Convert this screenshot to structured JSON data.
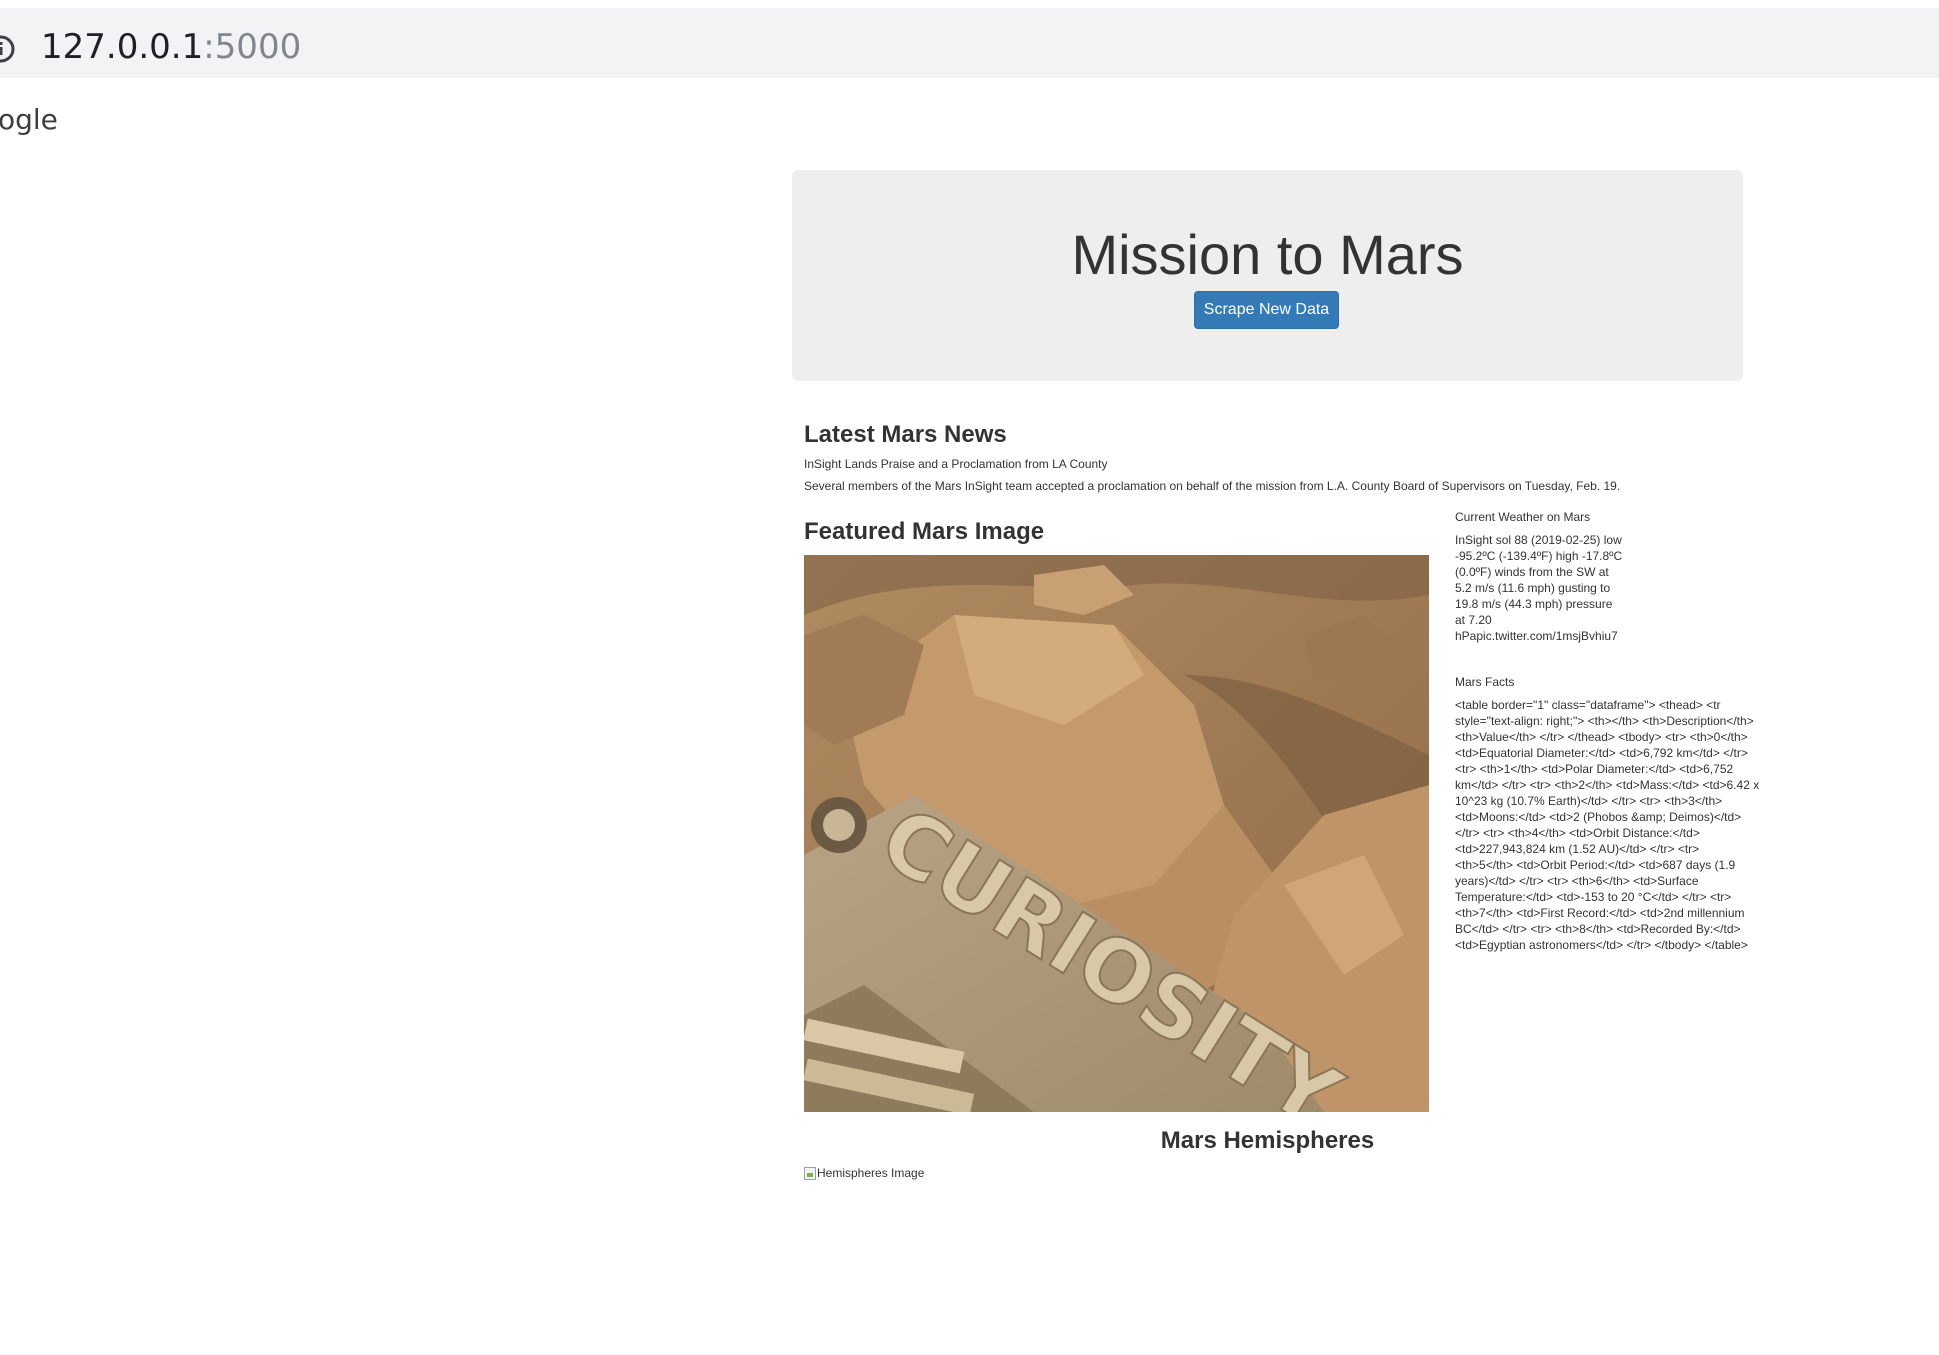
{
  "browser": {
    "url_host": "127.0.0.1",
    "url_port": ":5000",
    "info_icon": "info-icon",
    "bookmark_fragment": "ogle"
  },
  "jumbotron": {
    "title": "Mission to Mars",
    "scrape_button_label": "Scrape New Data",
    "button_color": "#337ab7",
    "background_color": "#eeeeee"
  },
  "news": {
    "heading": "Latest Mars News",
    "title": "InSight Lands Praise and a Proclamation from LA County",
    "paragraph": "Several members of the Mars InSight team accepted a proclamation on behalf of the mission from L.A. County Board of Supervisors on Tuesday, Feb. 19."
  },
  "featured": {
    "heading": "Featured Mars Image",
    "image_text": "CURIOSITY"
  },
  "weather": {
    "heading": "Current Weather on Mars",
    "text": "InSight sol 88 (2019-02-25) low -95.2ºC (-139.4ºF) high -17.8ºC (0.0ºF) winds from the SW at 5.2 m/s (11.6 mph) gusting to 19.8 m/s (44.3 mph) pressure at 7.20 hPapic.twitter.com/1msjBvhiu7"
  },
  "facts": {
    "heading": "Mars Facts",
    "text": "<table border=\"1\" class=\"dataframe\"> <thead> <tr style=\"text-align: right;\"> <th></th> <th>Description</th> <th>Value</th> </tr> </thead> <tbody> <tr> <th>0</th> <td>Equatorial Diameter:</td> <td>6,792 km</td> </tr> <tr> <th>1</th> <td>Polar Diameter:</td> <td>6,752 km</td> </tr> <tr> <th>2</th> <td>Mass:</td> <td>6.42 x 10^23 kg (10.7% Earth)</td> </tr> <tr> <th>3</th> <td>Moons:</td> <td>2 (Phobos &amp; Deimos)</td> </tr> <tr> <th>4</th> <td>Orbit Distance:</td> <td>227,943,824 km (1.52 AU)</td> </tr> <tr> <th>5</th> <td>Orbit Period:</td> <td>687 days (1.9 years)</td> </tr> <tr> <th>6</th> <td>Surface Temperature:</td> <td>-153 to 20 °C</td> </tr> <tr> <th>7</th> <td>First Record:</td> <td>2nd millennium BC</td> </tr> <tr> <th>8</th> <td>Recorded By:</td> <td>Egyptian astronomers</td> </tr> </tbody> </table>"
  },
  "hemispheres": {
    "heading": "Mars Hemispheres",
    "image_alt": "Hemispheres Image"
  }
}
